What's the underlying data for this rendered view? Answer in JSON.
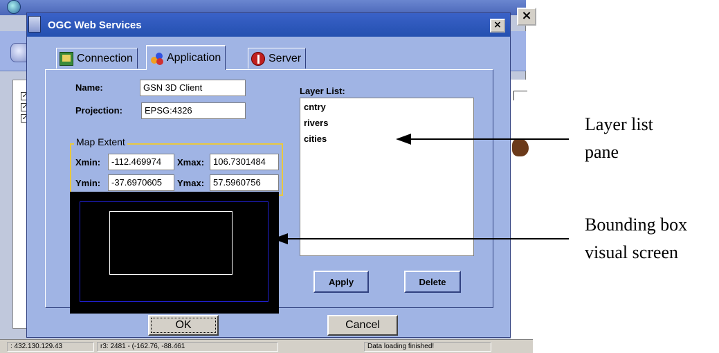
{
  "dialog": {
    "title": "OGC Web Services",
    "close_glyph": "×",
    "tabs": [
      {
        "label": "Connection",
        "icon": "connection-icon"
      },
      {
        "label": "Application",
        "icon": "application-icon"
      },
      {
        "label": "Server",
        "icon": "server-icon"
      }
    ],
    "active_tab": "Application",
    "fields": {
      "name_label": "Name:",
      "name_value": "GSN 3D Client",
      "projection_label": "Projection:",
      "projection_value": "EPSG:4326"
    },
    "map_extent": {
      "legend": "Map Extent",
      "xmin_label": "Xmin:",
      "xmin_value": "-112.469974",
      "xmax_label": "Xmax:",
      "xmax_value": "106.7301484",
      "ymin_label": "Ymin:",
      "ymin_value": "-37.6970605",
      "ymax_label": "Ymax:",
      "ymax_value": "57.5960756"
    },
    "layer_list": {
      "title": "Layer List:",
      "items": [
        "cntry",
        "rivers",
        "cities"
      ]
    },
    "buttons": {
      "apply": "Apply",
      "delete": "Delete",
      "ok": "OK",
      "cancel": "Cancel"
    }
  },
  "background_window": {
    "close_glyph": "×",
    "check_glyph": "✓",
    "status": {
      "cell1": ": 432.130.129.43",
      "cell2": "r3: 2481 - (-162.76, -88.461",
      "cell3": "Data loading finished!"
    }
  },
  "annotations": {
    "layer_list_line1": "Layer list",
    "layer_list_line2": "pane",
    "bbox_line1": "Bounding box",
    "bbox_line2": "visual screen"
  },
  "colors": {
    "dialog_bg": "#a0b4e4",
    "titlebar": "#2450b0",
    "extent_border": "#e8c840",
    "bbox_outer": "#2020d0"
  }
}
